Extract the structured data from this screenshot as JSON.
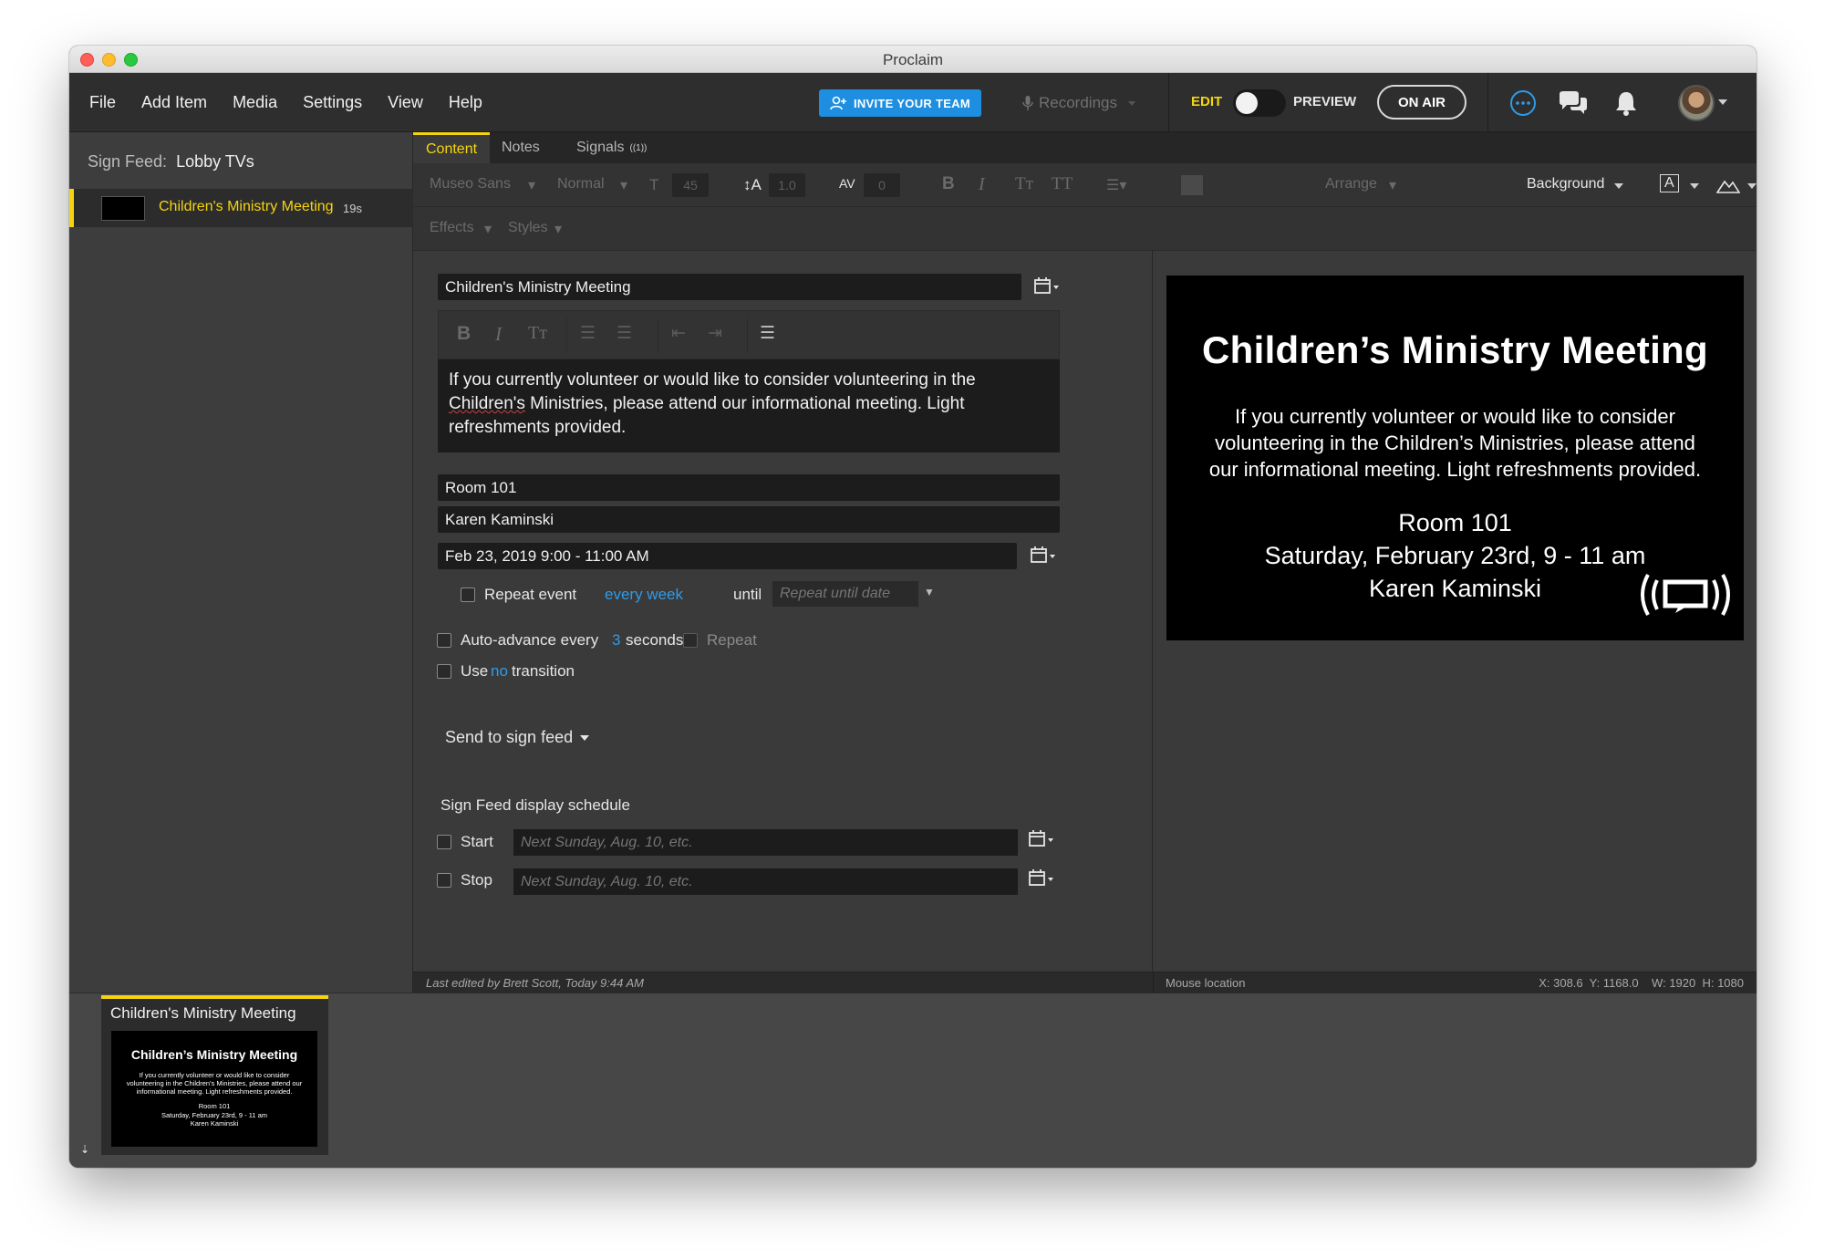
{
  "window": {
    "title": "Proclaim"
  },
  "menu": [
    "File",
    "Add Item",
    "Media",
    "Settings",
    "View",
    "Help"
  ],
  "topbar": {
    "invite_label": "INVITE YOUR TEAM",
    "recordings_label": "Recordings",
    "edit_label": "EDIT",
    "preview_label": "PREVIEW",
    "onair_label": "ON AIR"
  },
  "sidebar": {
    "feed_label": "Sign Feed:",
    "feed_name": "Lobby TVs",
    "items": [
      {
        "label": "Children's Ministry Meeting",
        "duration": "19s"
      }
    ]
  },
  "tabs": [
    {
      "label": "Content",
      "active": true
    },
    {
      "label": "Notes",
      "active": false
    },
    {
      "label": "Signals",
      "active": false
    }
  ],
  "signals_badge": "((1))",
  "toolbar": {
    "font": "Museo Sans",
    "weight": "Normal",
    "font_size": "45",
    "line_height": "1.0",
    "spacing": "0",
    "arrange": "Arrange",
    "background": "Background",
    "effects": "Effects",
    "styles": "Styles"
  },
  "editor": {
    "title": "Children's Ministry Meeting",
    "body_pre": "If you currently volunteer or would like to consider volunteering in the ",
    "body_underlined": "Children's",
    "body_post": " Ministries, please attend our informational meeting. Light refreshments provided.",
    "location": "Room 101",
    "contact": "Karen Kaminski",
    "datetime": "Feb 23, 2019 9:00 - 11:00 AM",
    "repeat_label": "Repeat event",
    "repeat_freq": "every week",
    "until_label": "until",
    "repeat_until_placeholder": "Repeat until date",
    "auto_advance_label": "Auto-advance every",
    "auto_advance_value": "3",
    "seconds_label": "seconds",
    "repeat2_label": "Repeat",
    "use_label": "Use",
    "transition_value": "no",
    "transition_label": "transition",
    "send_label": "Send to sign feed",
    "schedule_heading": "Sign Feed display schedule",
    "start_label": "Start",
    "stop_label": "Stop",
    "date_placeholder": "Next Sunday, Aug. 10, etc."
  },
  "status": {
    "last_edited": "Last edited by Brett Scott, Today 9:44 AM",
    "mouse_label": "Mouse location",
    "coords": "X: 308.6  Y: 1168.0    W: 1920  H: 1080"
  },
  "slide": {
    "title": "Children’s Ministry Meeting",
    "body": "If you currently volunteer or would like to consider volunteering in the Children’s Ministries, please attend our informational meeting. Light refreshments provided.",
    "line1": "Room 101",
    "line2": "Saturday, February 23rd, 9 - 11 am",
    "line3": "Karen Kaminski"
  },
  "strip": {
    "card_title": "Children's Ministry Meeting"
  },
  "colors": {
    "accent": "#f5d40f",
    "link": "#2f9be8",
    "invite": "#1e8fe0"
  }
}
